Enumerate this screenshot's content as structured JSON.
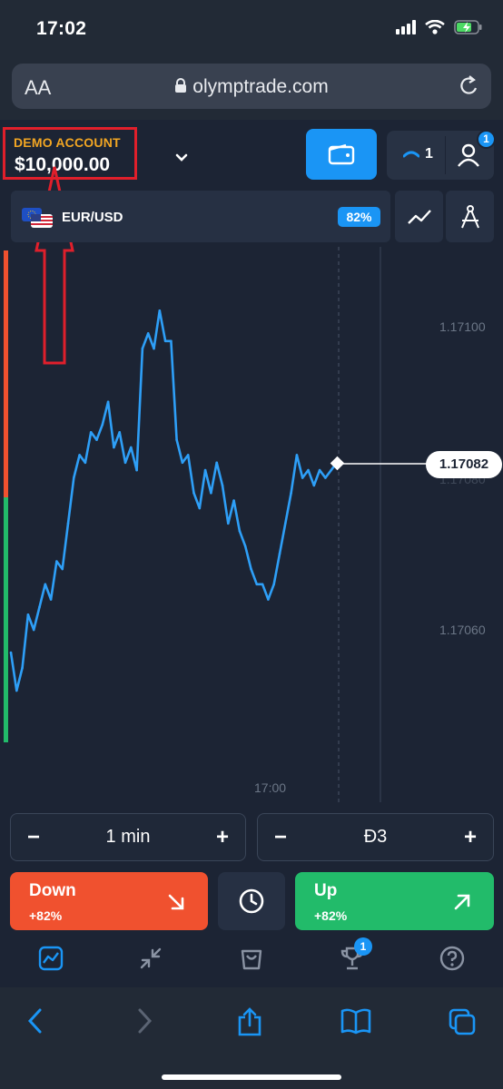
{
  "status_bar": {
    "time": "17:02"
  },
  "browser": {
    "text_size_label": "AA",
    "url": "olymptrade.com"
  },
  "account": {
    "type_label": "DEMO ACCOUNT",
    "balance": "$10,000.00",
    "open_trades_count": "1",
    "notifications_count": "1"
  },
  "asset": {
    "name": "EUR/USD",
    "payout": "82%"
  },
  "chart_data": {
    "type": "line",
    "title": "",
    "xlabel": "",
    "ylabel": "",
    "y_ticks": [
      "1.17100",
      "1.17080",
      "1.17060"
    ],
    "x_ticks": [
      "17:00"
    ],
    "current_price": "1.17082",
    "series": [
      {
        "values": [
          1.17057,
          1.17052,
          1.17055,
          1.17062,
          1.1706,
          1.17063,
          1.17066,
          1.17064,
          1.17069,
          1.17068,
          1.17074,
          1.1708,
          1.17083,
          1.17082,
          1.17086,
          1.17085,
          1.17087,
          1.1709,
          1.17084,
          1.17086,
          1.17082,
          1.17084,
          1.17081,
          1.17097,
          1.17099,
          1.17097,
          1.17102,
          1.17098,
          1.17098,
          1.17085,
          1.17082,
          1.17083,
          1.17078,
          1.17076,
          1.17081,
          1.17078,
          1.17082,
          1.17079,
          1.17074,
          1.17077,
          1.17073,
          1.17071,
          1.17068,
          1.17066,
          1.17066,
          1.17064,
          1.17066,
          1.1707,
          1.17074,
          1.17078,
          1.17083,
          1.1708,
          1.17081,
          1.17079,
          1.17081,
          1.1708,
          1.17081,
          1.17082
        ]
      }
    ],
    "colors": {
      "line": "#2e9ff7",
      "down": "#f0512f",
      "up": "#22bb6a"
    }
  },
  "controls": {
    "duration": "1 min",
    "amount": "Đ3",
    "minus": "−",
    "plus": "+",
    "down_label": "Down",
    "down_payout": "+82%",
    "up_label": "Up",
    "up_payout": "+82%"
  },
  "nav": {
    "trophy_badge": "1"
  }
}
